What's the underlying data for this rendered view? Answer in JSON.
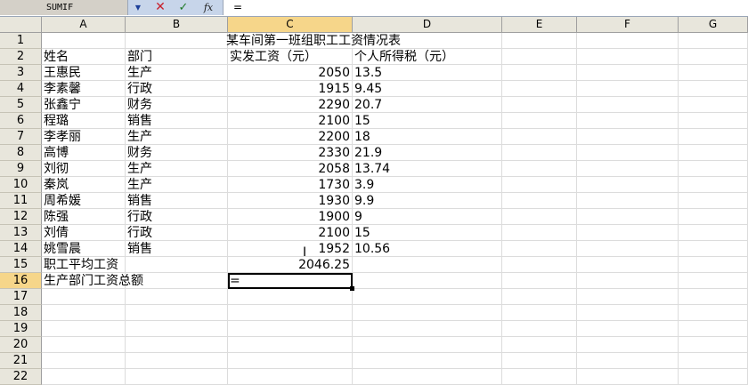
{
  "formula_bar": {
    "name_box": "SUMIF",
    "dropdown_icon": "dropdown-arrow-icon",
    "cancel_icon": "cancel-x-icon",
    "enter_icon": "enter-check-icon",
    "function_icon": "fx-icon",
    "function_label": "fx",
    "formula": "="
  },
  "columns": [
    "A",
    "B",
    "C",
    "D",
    "E",
    "F",
    "G"
  ],
  "active_column": "C",
  "active_row": "16",
  "rows": [
    {
      "n": "1",
      "a": "",
      "b": "",
      "c": "某车间第一班组职工工资情况表",
      "d": "",
      "c_align": "title"
    },
    {
      "n": "2",
      "a": "姓名",
      "b": "部门",
      "c": "实发工资（元）",
      "d": "个人所得税（元）"
    },
    {
      "n": "3",
      "a": "王惠民",
      "b": "生产",
      "c": "2050",
      "d": "13.5"
    },
    {
      "n": "4",
      "a": "李素馨",
      "b": "行政",
      "c": "1915",
      "d": "9.45"
    },
    {
      "n": "5",
      "a": "张鑫宁",
      "b": "财务",
      "c": "2290",
      "d": "20.7"
    },
    {
      "n": "6",
      "a": "程璐",
      "b": "销售",
      "c": "2100",
      "d": "15"
    },
    {
      "n": "7",
      "a": "李孝丽",
      "b": "生产",
      "c": "2200",
      "d": "18"
    },
    {
      "n": "8",
      "a": "高博",
      "b": "财务",
      "c": "2330",
      "d": "21.9"
    },
    {
      "n": "9",
      "a": "刘彻",
      "b": "生产",
      "c": "2058",
      "d": "13.74"
    },
    {
      "n": "10",
      "a": "秦岚",
      "b": "生产",
      "c": "1730",
      "d": "3.9"
    },
    {
      "n": "11",
      "a": "周希媛",
      "b": "销售",
      "c": "1930",
      "d": "9.9"
    },
    {
      "n": "12",
      "a": "陈强",
      "b": "行政",
      "c": "1900",
      "d": "9"
    },
    {
      "n": "13",
      "a": "刘倩",
      "b": "行政",
      "c": "2100",
      "d": "15"
    },
    {
      "n": "14",
      "a": "姚雪晨",
      "b": "销售",
      "c": "1952",
      "d": "10.56"
    },
    {
      "n": "15",
      "a": "职工平均工资",
      "b": "",
      "c": "2046.25",
      "d": ""
    },
    {
      "n": "16",
      "a": "生产部门工资总额",
      "b": "",
      "c": "=",
      "d": ""
    },
    {
      "n": "17",
      "a": "",
      "b": "",
      "c": "",
      "d": ""
    },
    {
      "n": "18",
      "a": "",
      "b": "",
      "c": "",
      "d": ""
    },
    {
      "n": "19",
      "a": "",
      "b": "",
      "c": "",
      "d": ""
    },
    {
      "n": "20",
      "a": "",
      "b": "",
      "c": "",
      "d": ""
    },
    {
      "n": "21",
      "a": "",
      "b": "",
      "c": "",
      "d": ""
    },
    {
      "n": "22",
      "a": "",
      "b": "",
      "c": "",
      "d": ""
    }
  ]
}
